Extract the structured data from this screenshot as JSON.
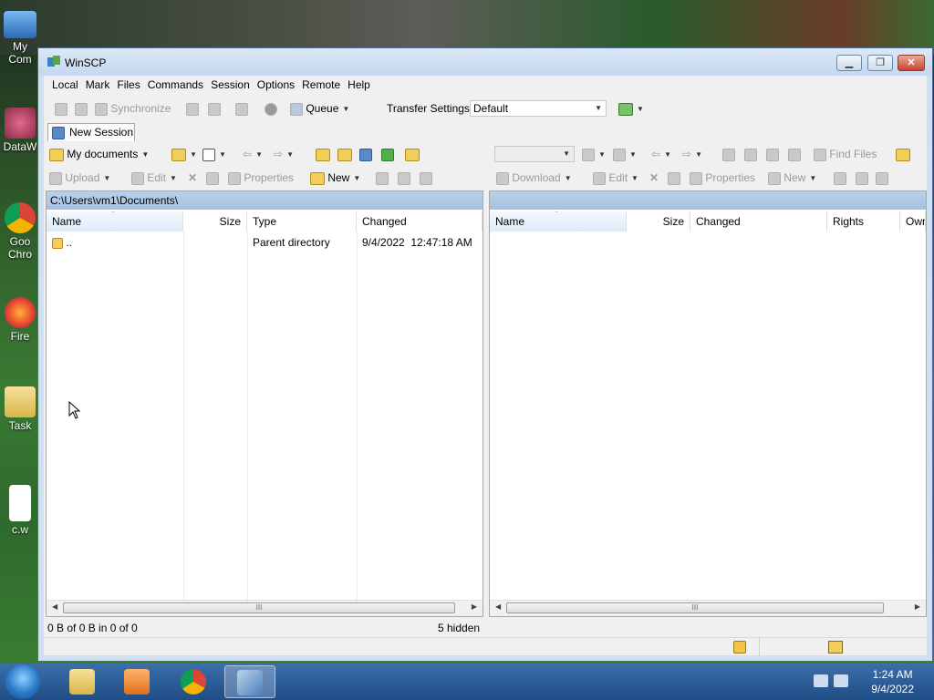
{
  "desktop": {
    "icons": [
      {
        "label": "My Com"
      },
      {
        "label": "DataW"
      },
      {
        "label": "Goo Chro"
      },
      {
        "label": "Fire"
      },
      {
        "label": "Task"
      },
      {
        "label": "c.w"
      }
    ]
  },
  "window": {
    "title": "WinSCP",
    "menu": [
      "Local",
      "Mark",
      "Files",
      "Commands",
      "Session",
      "Options",
      "Remote",
      "Help"
    ],
    "toolbar1": {
      "synchronize": "Synchronize",
      "queue": "Queue",
      "transfer_settings_label": "Transfer Settings",
      "transfer_settings_value": "Default"
    },
    "new_session_tab": "New Session",
    "local": {
      "location": "My documents",
      "upload": "Upload",
      "edit": "Edit",
      "properties": "Properties",
      "new": "New",
      "path": "C:\\Users\\vm1\\Documents\\",
      "columns": [
        "Name",
        "Size",
        "Type",
        "Changed"
      ],
      "rows": [
        {
          "name": "..",
          "size": "",
          "type": "Parent directory",
          "changed": "9/4/2022  12:47:18 AM"
        }
      ],
      "status_left": "0 B of 0 B in 0 of 0",
      "status_right": "5 hidden"
    },
    "remote": {
      "find_files": "Find Files",
      "download": "Download",
      "edit": "Edit",
      "properties": "Properties",
      "new": "New",
      "columns": [
        "Name",
        "Size",
        "Changed",
        "Rights",
        "Owr"
      ]
    }
  },
  "taskbar": {
    "time": "1:24 AM",
    "date": "9/4/2022"
  },
  "colors": {
    "titlebar": "#c4d8ef",
    "path_bar": "#a4c0e0",
    "taskbar": "#2a5a92"
  }
}
